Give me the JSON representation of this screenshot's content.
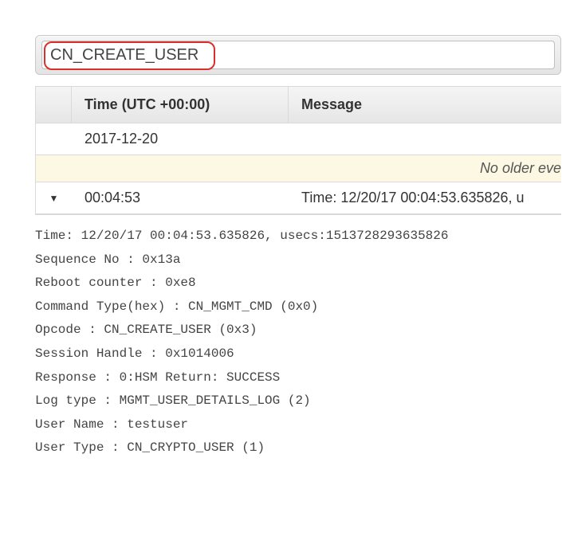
{
  "search": {
    "value": "CN_CREATE_USER"
  },
  "columns": {
    "time": "Time (UTC +00:00)",
    "message": "Message"
  },
  "date_group": "2017-12-20",
  "older_notice": "No older eve",
  "event": {
    "time": "00:04:53",
    "message_preview": "Time: 12/20/17 00:04:53.635826, u"
  },
  "details": {
    "line0": "Time: 12/20/17 00:04:53.635826, usecs:1513728293635826",
    "line1": "Sequence No : 0x13a",
    "line2": "Reboot counter : 0xe8",
    "line3": "Command Type(hex) : CN_MGMT_CMD (0x0)",
    "line4": "Opcode : CN_CREATE_USER (0x3)",
    "line5": "Session Handle : 0x1014006",
    "line6": "Response : 0:HSM Return: SUCCESS",
    "line7": "Log type : MGMT_USER_DETAILS_LOG (2)",
    "line8": "User Name : testuser",
    "line9": "User Type : CN_CRYPTO_USER (1)"
  }
}
